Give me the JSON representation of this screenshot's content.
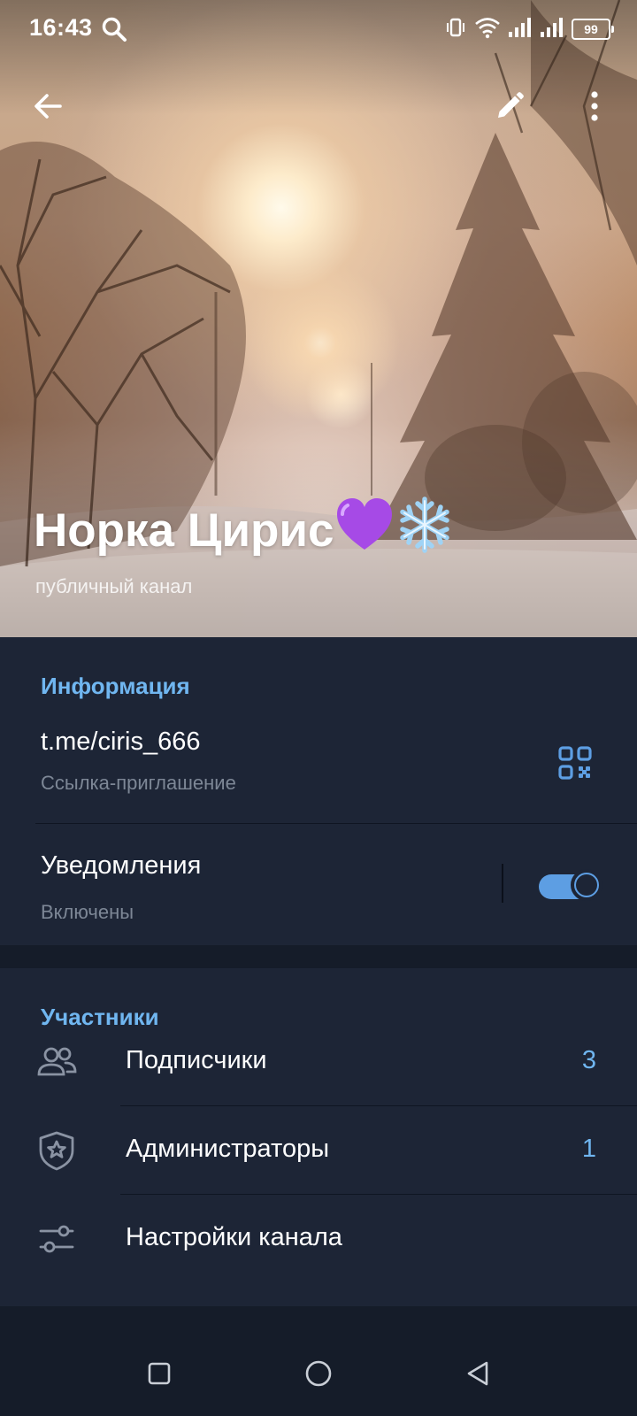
{
  "status_bar": {
    "time": "16:43",
    "battery": "99",
    "icons": [
      "search-icon",
      "vibrate-icon",
      "wifi-icon",
      "signal-icon",
      "signal-icon",
      "battery-icon"
    ]
  },
  "toolbar": {
    "back_icon": "arrow-left-icon",
    "edit_icon": "pencil-icon",
    "more_icon": "more-vertical-icon"
  },
  "profile": {
    "title": "Норка Цирис",
    "title_emoji": [
      "💜",
      "❄️"
    ],
    "subtitle": "публичный канал"
  },
  "info_section": {
    "header": "Информация",
    "link": "t.me/ciris_666",
    "link_caption": "Ссылка-приглашение",
    "qr_icon": "qr-code-icon",
    "notifications_label": "Уведомления",
    "notifications_status": "Включены",
    "notifications_enabled": true
  },
  "members_section": {
    "header": "Участники",
    "items": [
      {
        "icon": "users-icon",
        "label": "Подписчики",
        "count": "3"
      },
      {
        "icon": "shield-star-icon",
        "label": "Администраторы",
        "count": "1"
      },
      {
        "icon": "sliders-icon",
        "label": "Настройки канала",
        "count": ""
      }
    ]
  },
  "nav_bar": {
    "icons": [
      "square-icon",
      "circle-icon",
      "triangle-back-icon"
    ]
  },
  "colors": {
    "accent": "#70b6f0",
    "toggle": "#5d9ee3",
    "section_bg": "#1d2536",
    "page_bg": "#151c29",
    "secondary_text": "#7d8796"
  }
}
